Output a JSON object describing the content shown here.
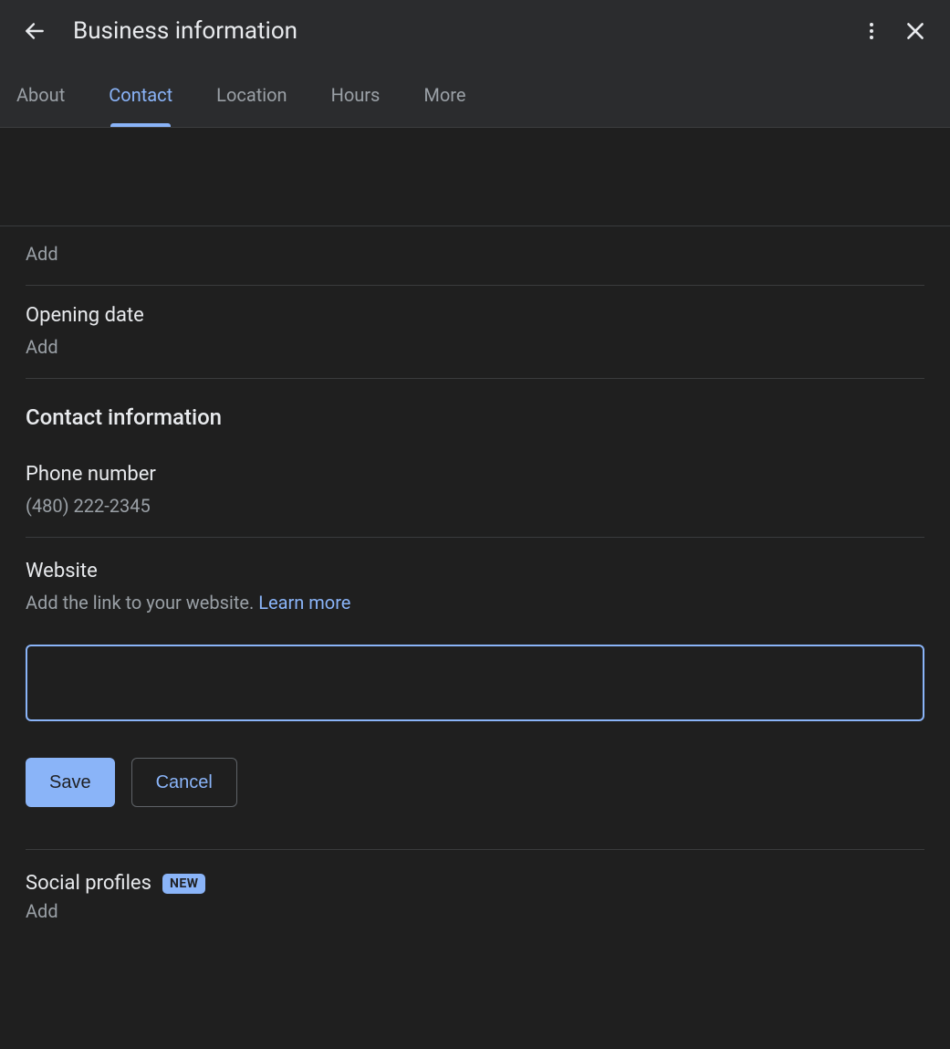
{
  "header": {
    "title": "Business information"
  },
  "tabs": {
    "about": "About",
    "contact": "Contact",
    "location": "Location",
    "hours": "Hours",
    "more": "More",
    "active": "contact"
  },
  "rows": {
    "addTop": "Add",
    "openingDate": {
      "label": "Opening date",
      "value": "Add"
    }
  },
  "contactSection": {
    "title": "Contact information",
    "phone": {
      "label": "Phone number",
      "value": "(480) 222-2345"
    },
    "website": {
      "label": "Website",
      "helper": "Add the link to your website. ",
      "learnMore": "Learn more",
      "inputValue": ""
    },
    "saveLabel": "Save",
    "cancelLabel": "Cancel"
  },
  "social": {
    "title": "Social profiles",
    "badge": "NEW",
    "add": "Add"
  }
}
